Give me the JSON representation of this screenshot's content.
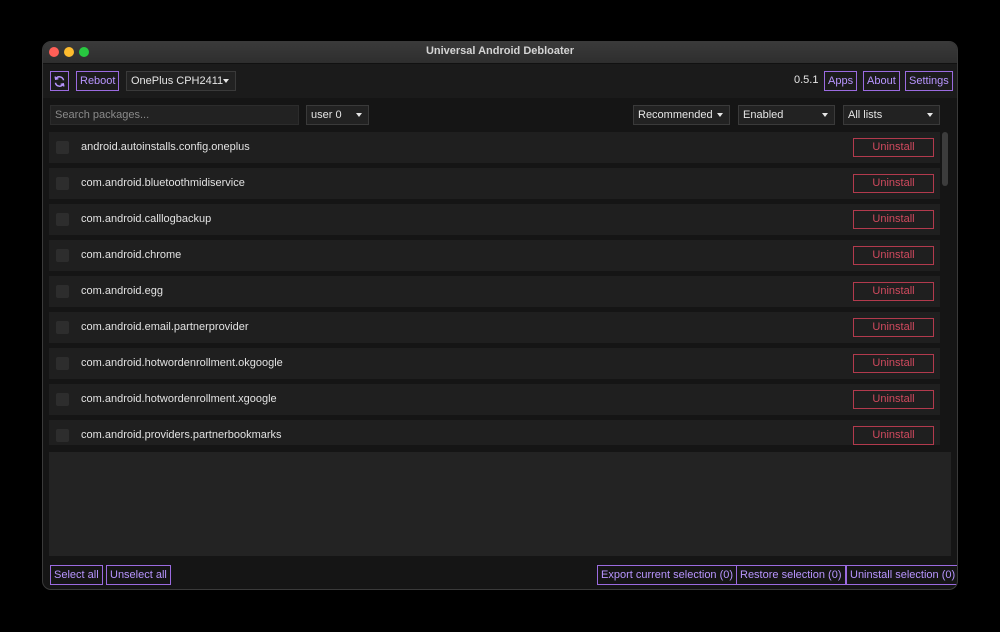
{
  "window": {
    "title": "Universal Android Debloater"
  },
  "toolbar": {
    "refresh_icon": "refresh-icon",
    "reboot_label": "Reboot",
    "device_selected": "OnePlus CPH2411",
    "version": "0.5.1",
    "apps_label": "Apps",
    "about_label": "About",
    "settings_label": "Settings"
  },
  "filters": {
    "search_placeholder": "Search packages...",
    "user_selected": "user 0",
    "removal_selected": "Recommended",
    "state_selected": "Enabled",
    "list_selected": "All lists"
  },
  "packages": [
    {
      "name": "android.autoinstalls.config.oneplus",
      "action": "Uninstall"
    },
    {
      "name": "com.android.bluetoothmidiservice",
      "action": "Uninstall"
    },
    {
      "name": "com.android.calllogbackup",
      "action": "Uninstall"
    },
    {
      "name": "com.android.chrome",
      "action": "Uninstall"
    },
    {
      "name": "com.android.egg",
      "action": "Uninstall"
    },
    {
      "name": "com.android.email.partnerprovider",
      "action": "Uninstall"
    },
    {
      "name": "com.android.hotwordenrollment.okgoogle",
      "action": "Uninstall"
    },
    {
      "name": "com.android.hotwordenrollment.xgoogle",
      "action": "Uninstall"
    },
    {
      "name": "com.android.providers.partnerbookmarks",
      "action": "Uninstall"
    }
  ],
  "bottom": {
    "select_all": "Select all",
    "unselect_all": "Unselect all",
    "export": "Export current selection (0)",
    "restore": "Restore selection (0)",
    "uninstall": "Uninstall selection (0)"
  },
  "colors": {
    "accent": "#9b6be0",
    "danger": "#b23a4d",
    "background": "#151515"
  }
}
